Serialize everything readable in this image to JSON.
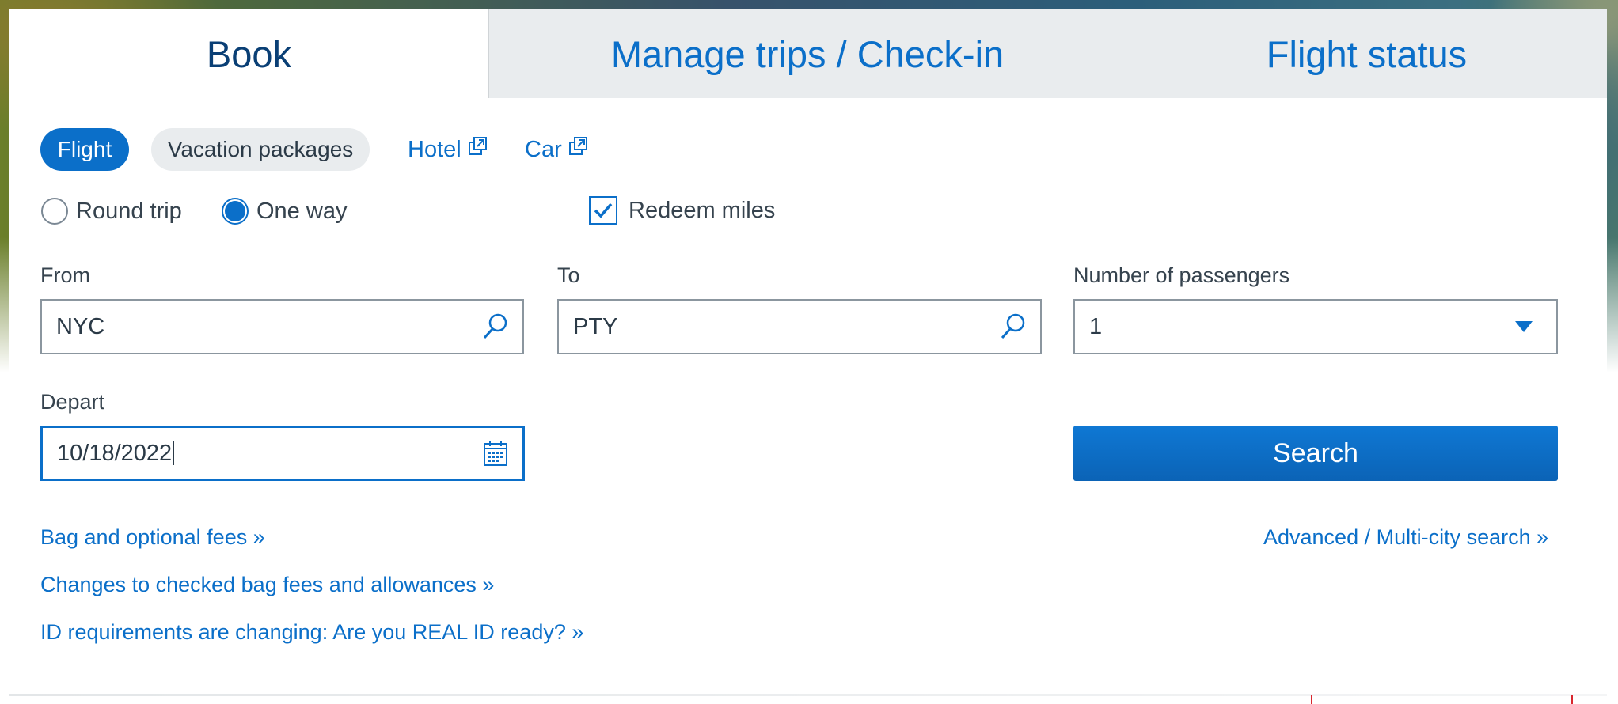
{
  "tabs": {
    "book": "Book",
    "manage": "Manage trips / Check-in",
    "status": "Flight status"
  },
  "trip_type": {
    "flight": "Flight",
    "vacation": "Vacation packages",
    "hotel": "Hotel",
    "car": "Car"
  },
  "options": {
    "round_trip": "Round trip",
    "one_way": "One way",
    "redeem_miles": "Redeem miles",
    "selected_trip": "One way",
    "redeem_checked": true
  },
  "form": {
    "from_label": "From",
    "from_value": "NYC",
    "to_label": "To",
    "to_value": "PTY",
    "passengers_label": "Number of passengers",
    "passengers_value": "1",
    "depart_label": "Depart",
    "depart_value": "10/18/2022",
    "search_label": "Search"
  },
  "links": {
    "bag_fees": "Bag and optional fees »",
    "changes": "Changes to checked bag fees and allowances »",
    "real_id": "ID requirements are changing: Are you REAL ID ready? »",
    "advanced": "Advanced / Multi-city search »"
  },
  "colors": {
    "accent": "#0b6fc9",
    "tab_inactive_bg": "#e9ecee",
    "active_tab_text": "#0a3f75",
    "text": "#36434e"
  }
}
